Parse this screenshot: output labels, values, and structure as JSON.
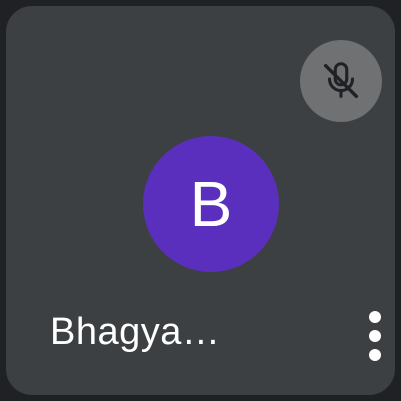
{
  "participant": {
    "avatar_letter": "B",
    "name": "Bhagya…"
  },
  "icons": {
    "mic_status": "mic-off-icon",
    "menu": "more-vert-icon"
  },
  "colors": {
    "tile_background": "#3c4043",
    "avatar_background": "#5b2fbd",
    "mic_badge_background": "#6f7173"
  }
}
